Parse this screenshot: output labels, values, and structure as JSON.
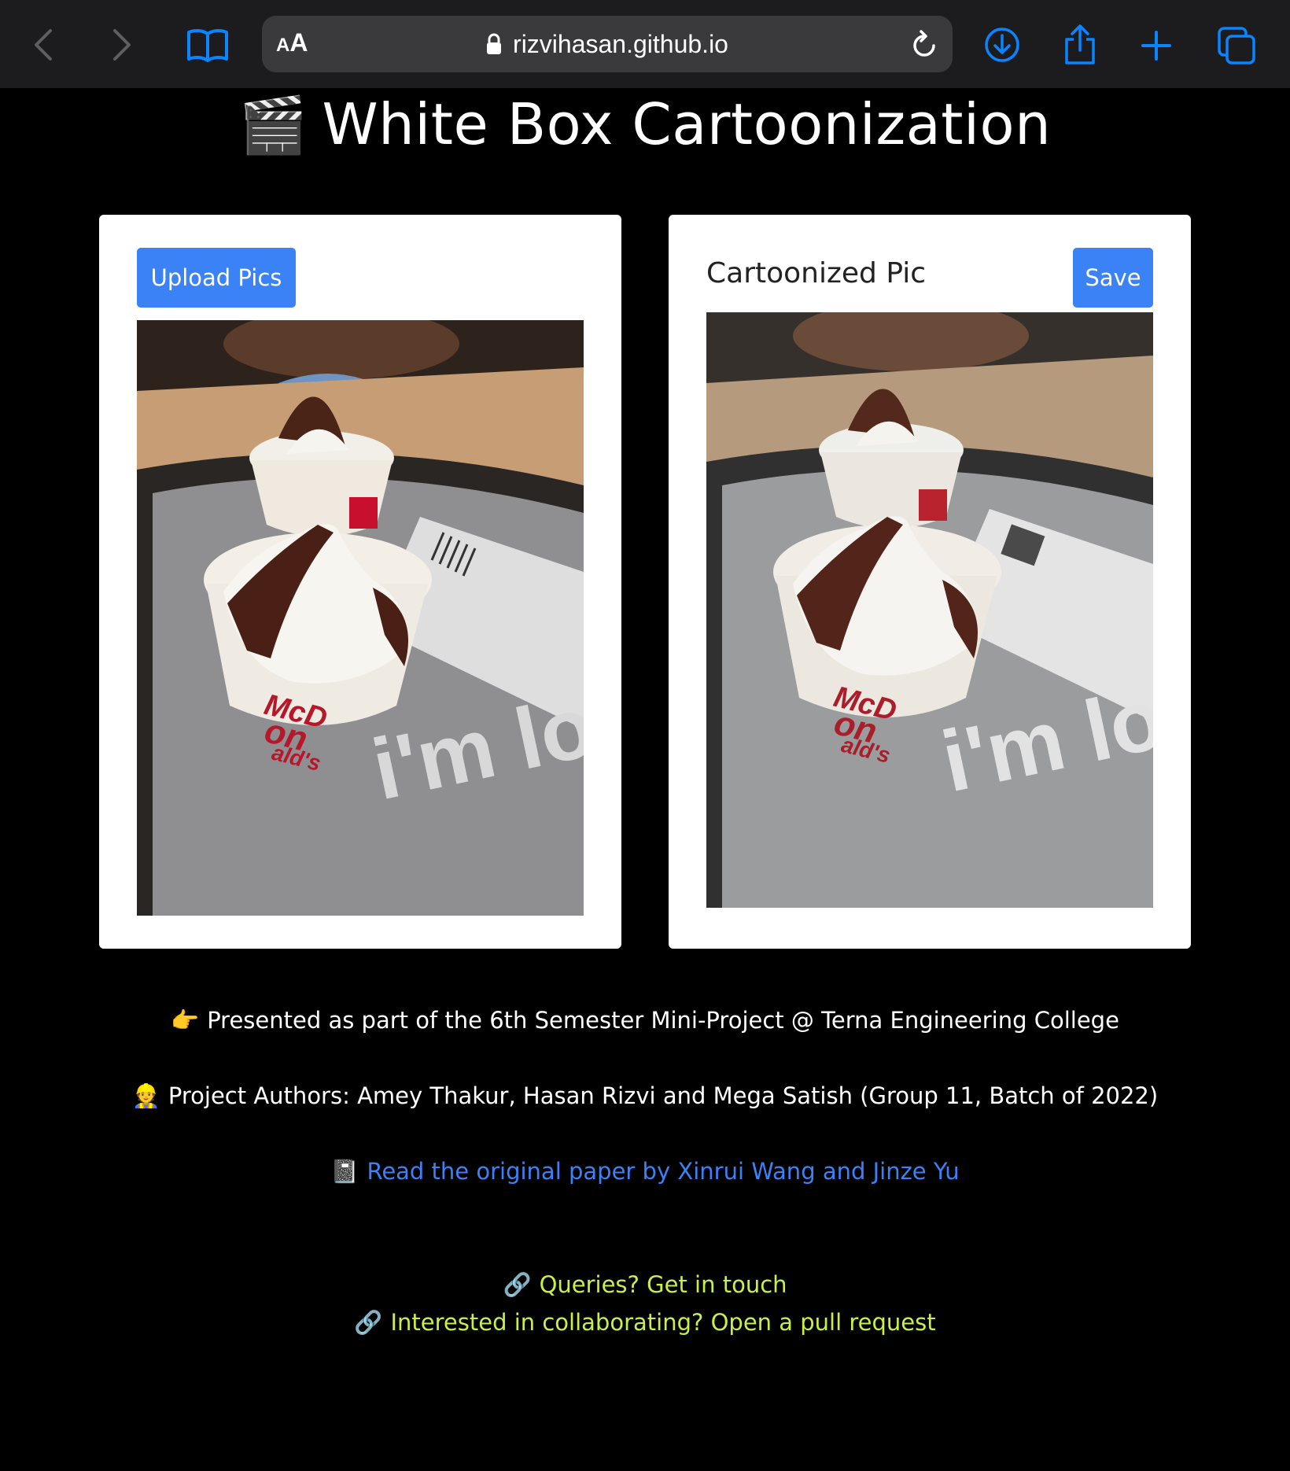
{
  "browser": {
    "url_size_small": "A",
    "url_size_big": "A",
    "url": "rizvihasan.github.io",
    "icons": [
      "back-icon",
      "forward-icon",
      "bookmarks-icon",
      "lock-icon",
      "reload-icon",
      "downloads-icon",
      "share-icon",
      "new-tab-icon",
      "tabs-icon"
    ]
  },
  "page": {
    "title_emoji": "🎬",
    "title": "White Box Cartoonization",
    "upload_label": "Upload Pics",
    "cartoon_heading": "Cartoonized Pic",
    "save_label": "Save",
    "presented_emoji": "👉",
    "presented_text": "Presented as part of the 6th Semester Mini-Project @ Terna Engineering College",
    "authors_emoji": "👷",
    "authors_text": "Project Authors: Amey Thakur, Hasan Rizvi and Mega Satish (Group 11, Batch of 2022)",
    "paper_emoji": "📓",
    "paper_link": "Read the original paper by Xinrui Wang and Jinze Yu",
    "link_emoji": "🔗",
    "queries_link": "Queries? Get in touch",
    "collab_link": "Interested in collaborating? Open a pull request"
  },
  "images": {
    "photo_words": [
      "McD",
      "on",
      "ald's",
      "i'm lo"
    ]
  },
  "colors": {
    "accent_blue": "#3b82f6",
    "link_green": "#c8f049",
    "toolbar_icon_blue": "#0a84ff"
  }
}
